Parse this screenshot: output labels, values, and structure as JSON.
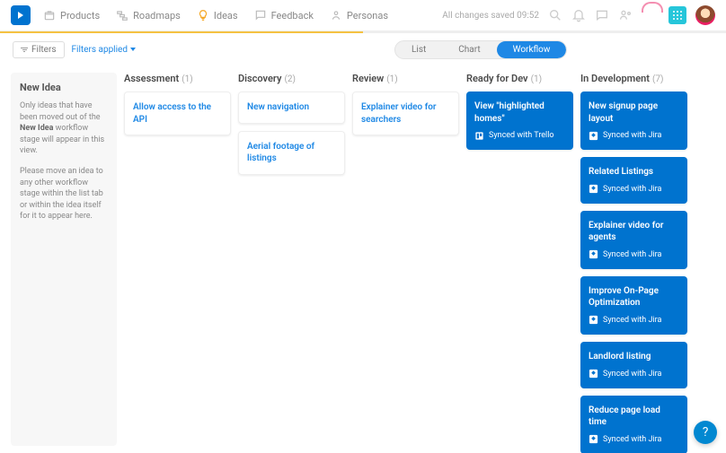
{
  "nav": {
    "items": [
      {
        "label": "Products"
      },
      {
        "label": "Roadmaps"
      },
      {
        "label": "Ideas"
      },
      {
        "label": "Feedback"
      },
      {
        "label": "Personas"
      }
    ],
    "save_status": "All changes saved 09:52"
  },
  "filters": {
    "button": "Filters",
    "applied": "Filters applied"
  },
  "views": {
    "list": "List",
    "chart": "Chart",
    "workflow": "Workflow"
  },
  "intro": {
    "title": "New Idea",
    "p1a": "Only ideas that have been moved out of the ",
    "p1b": "New Idea",
    "p1c": " workflow stage will appear in this view.",
    "p2": "Please move an idea to any other workflow stage within the list tab or within the idea itself for it to appear here."
  },
  "columns": [
    {
      "title": "Assessment",
      "count": "(1)",
      "cards": [
        {
          "title": "Allow access to the API",
          "style": "white"
        }
      ]
    },
    {
      "title": "Discovery",
      "count": "(2)",
      "cards": [
        {
          "title": "New navigation",
          "style": "white"
        },
        {
          "title": "Aerial footage of listings",
          "style": "white"
        }
      ]
    },
    {
      "title": "Review",
      "count": "(1)",
      "cards": [
        {
          "title": "Explainer video for searchers",
          "style": "white"
        }
      ]
    },
    {
      "title": "Ready for Dev",
      "count": "(1)",
      "cards": [
        {
          "title": "View \"highlighted homes\"",
          "sync": "Synced with Trello",
          "icon": "trello",
          "style": "blue"
        }
      ]
    },
    {
      "title": "In Development",
      "count": "(7)",
      "cards": [
        {
          "title": "New signup page layout",
          "sync": "Synced with Jira",
          "icon": "jira",
          "style": "blue"
        },
        {
          "title": "Related Listings",
          "sync": "Synced with Jira",
          "icon": "jira",
          "style": "blue"
        },
        {
          "title": "Explainer video for agents",
          "sync": "Synced with Jira",
          "icon": "jira",
          "style": "blue"
        },
        {
          "title": "Improve On-Page Optimization",
          "sync": "Synced with Jira",
          "icon": "jira",
          "style": "blue"
        },
        {
          "title": "Landlord listing",
          "sync": "Synced with Jira",
          "icon": "jira",
          "style": "blue"
        },
        {
          "title": "Reduce page load time",
          "sync": "Synced with Jira",
          "icon": "jira",
          "style": "blue"
        }
      ]
    }
  ],
  "help": "?"
}
